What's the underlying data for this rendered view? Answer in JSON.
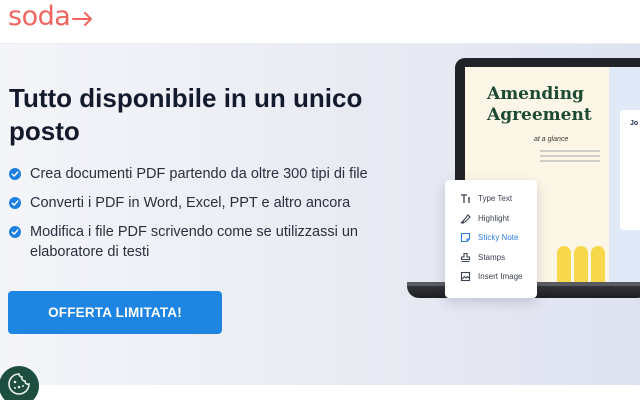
{
  "brand": {
    "name": "soda",
    "color": "#f2655f",
    "arrow_icon": "arrow-right-icon"
  },
  "hero": {
    "headline": "Tutto disponibile in un unico posto",
    "features": [
      "Crea documenti PDF partendo da oltre 300 tipi di file",
      "Converti i PDF in Word, Excel, PPT e altro ancora",
      "Modifica i file PDF scrivendo come se utilizzassi un elaboratore di testi"
    ],
    "bullet_icon": "check-circle-icon",
    "cta_label": "OFFERTA LIMITATA!",
    "accent_color": "#1f85e3"
  },
  "illustration": {
    "document_title": "Amending Agreement",
    "document_subtitle": "at a glance",
    "side_card_label": "Jo",
    "tools": [
      {
        "icon": "type-text-icon",
        "label": "Type Text",
        "active": false
      },
      {
        "icon": "highlight-icon",
        "label": "Highlight",
        "active": false
      },
      {
        "icon": "sticky-note-icon",
        "label": "Sticky Note",
        "active": true
      },
      {
        "icon": "stamp-icon",
        "label": "Stamps",
        "active": false
      },
      {
        "icon": "image-icon",
        "label": "Insert Image",
        "active": false
      }
    ]
  },
  "cookie_button": {
    "icon": "cookie-icon",
    "color": "#1d4e40"
  }
}
